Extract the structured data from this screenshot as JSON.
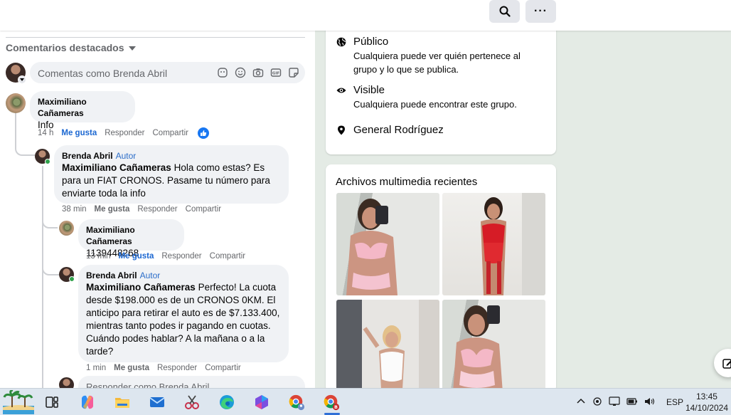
{
  "toolbar": {
    "search_icon": "search-icon",
    "more_label": "···"
  },
  "comments": {
    "section_label": "Comentarios destacados",
    "composer_placeholder": "Comentas como Brenda Abril",
    "items": [
      {
        "author": "Maximiliano Cañameras",
        "text": "Info",
        "time": "14 h",
        "like": "Me gusta",
        "reply": "Responder",
        "share": "Compartir",
        "reaction": "like"
      },
      {
        "author": "Brenda Abril",
        "tag": "Autor",
        "mention": "Maximiliano Cañameras",
        "text": " Hola como estas? Es para un FIAT CRONOS. Pasame tu número para enviarte toda la info",
        "time": "38 min",
        "like": "Me gusta",
        "reply": "Responder",
        "share": "Compartir"
      },
      {
        "author": "Maximiliano Cañameras",
        "text": "1139448268",
        "time": "13 min",
        "like": "Me gusta",
        "reply": "Responder",
        "share": "Compartir"
      },
      {
        "author": "Brenda Abril",
        "tag": "Autor",
        "mention": "Maximiliano Cañameras",
        "text": " Perfecto! La cuota desde $198.000 es de un CRONOS 0KM. El anticipo para retirar el auto es de $7.133.400, mientras tanto podes ir pagando en cuotas. Cuándo podes hablar? A la mañana o a la tarde?",
        "time": "1 min",
        "like": "Me gusta",
        "reply": "Responder",
        "share": "Compartir"
      }
    ],
    "reply_placeholder": "Responder como Brenda Abril"
  },
  "about": {
    "public_title": "Público",
    "public_desc": "Cualquiera puede ver quién pertenece al grupo y lo que se publica.",
    "visible_title": "Visible",
    "visible_desc": "Cualquiera puede encontrar este grupo.",
    "location": "General Rodríguez"
  },
  "media": {
    "title": "Archivos multimedia recientes"
  },
  "taskbar": {
    "language": "ESP",
    "time": "13:45",
    "date": "14/10/2024"
  },
  "colors": {
    "accent": "#1877f2",
    "online": "#31a24c",
    "author_tag": "#2b6dc9"
  }
}
